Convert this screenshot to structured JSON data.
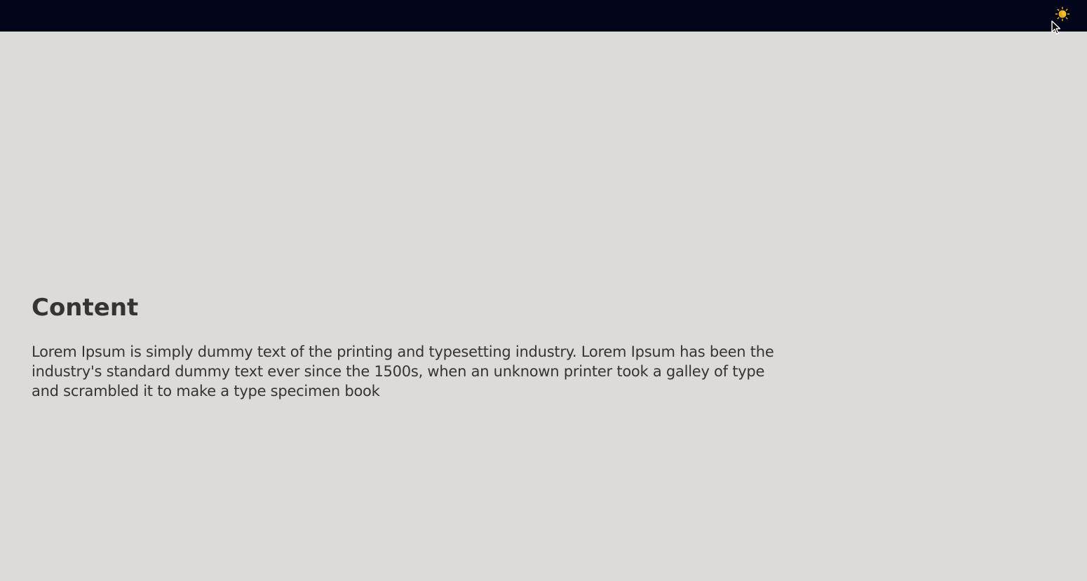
{
  "topbar": {
    "background_color": "#03051a",
    "theme_toggle_icon": "sun-icon",
    "icon_color": "#f5bf2d"
  },
  "main": {
    "title": "Content",
    "body": "Lorem Ipsum is simply dummy text of the printing and typesetting industry. Lorem Ipsum has been the industry's standard dummy text ever since the 1500s, when an unknown printer took a galley of type and scrambled it to make a type specimen book"
  },
  "page": {
    "background_color": "#dcdbd7",
    "text_color": "#353433"
  }
}
